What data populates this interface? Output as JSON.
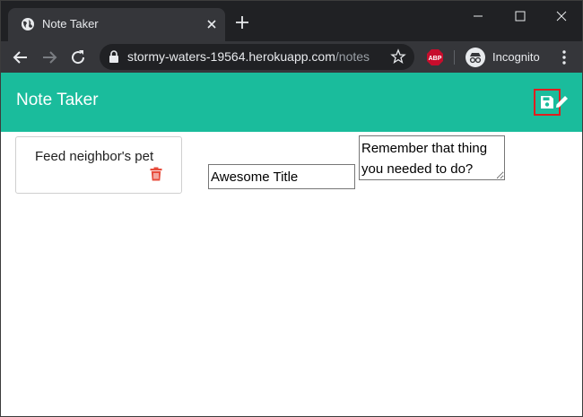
{
  "browser": {
    "tab": {
      "title": "Note Taker",
      "favicon": "globe-icon"
    },
    "omnibox": {
      "host": "stormy-waters-19564.herokuapp.com",
      "path": "/notes"
    },
    "extension": {
      "label": "ABP",
      "color": "#c70d2c"
    },
    "profile": {
      "label": "Incognito"
    }
  },
  "app": {
    "title": "Note Taker",
    "header_color": "#1abc9c",
    "notes": [
      {
        "title": "Feed neighbor's pet"
      }
    ],
    "editor": {
      "title_value": "Awesome Title",
      "body_value": "Remember that thing you needed to do?"
    }
  }
}
